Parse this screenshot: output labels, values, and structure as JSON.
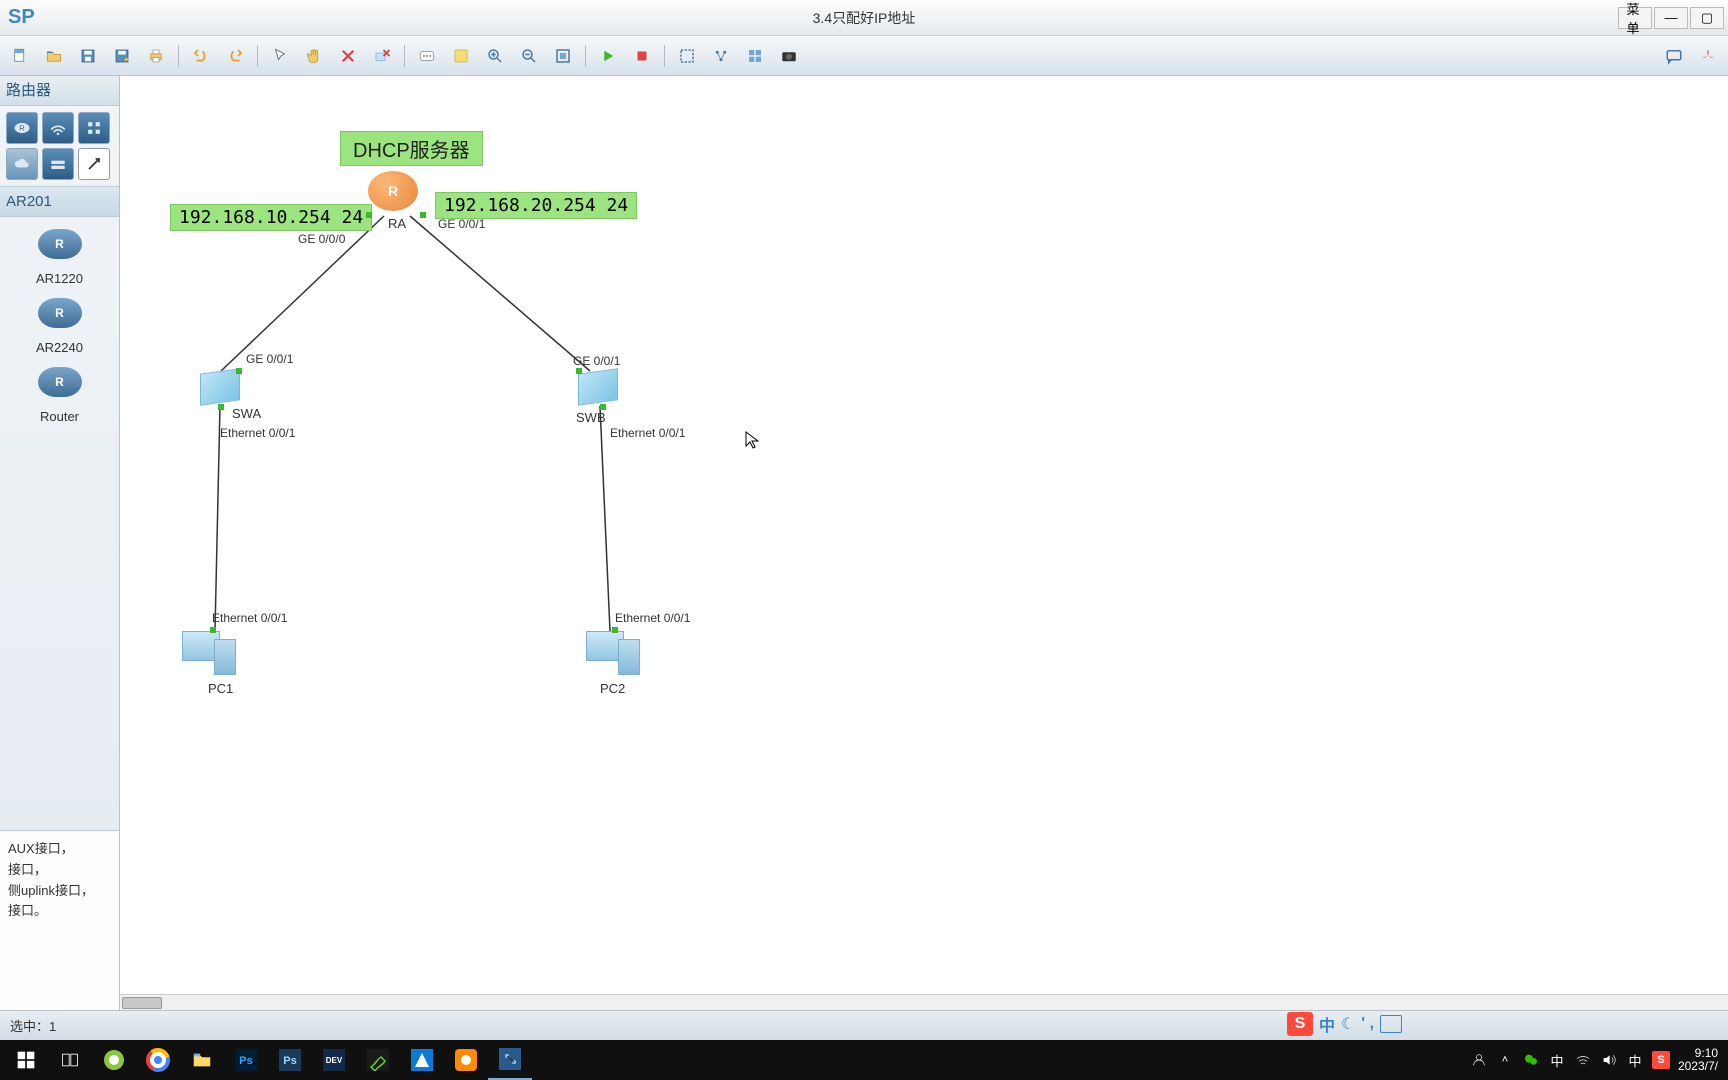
{
  "app": {
    "logo": "SP",
    "title": "3.4只配好IP地址",
    "menu_label": "菜 单"
  },
  "toolbar": {
    "icons": [
      "new",
      "open",
      "save",
      "save-as",
      "print",
      "undo",
      "redo",
      "pointer",
      "hand",
      "delete",
      "delete-node",
      "text",
      "note",
      "zoom-in",
      "zoom-out",
      "fit",
      "play",
      "stop",
      "capture",
      "arrange",
      "grid",
      "camera"
    ]
  },
  "left": {
    "category": "路由器",
    "model_title": "AR201",
    "devices": [
      "AR1220",
      "AR2240",
      "Router"
    ],
    "desc_lines": [
      "AUX接口，",
      "接口，",
      "侧uplink接口，",
      "接口。"
    ]
  },
  "topology": {
    "title": "DHCP服务器",
    "ip_left": "192.168.10.254 24",
    "ip_right": "192.168.20.254 24",
    "ra": {
      "name": "RA",
      "p0": "GE 0/0/0",
      "p1": "GE 0/0/1"
    },
    "swa": {
      "name": "SWA",
      "up": "GE 0/0/1",
      "down": "Ethernet 0/0/1"
    },
    "swb": {
      "name": "SWB",
      "up": "GE 0/0/1",
      "down": "Ethernet 0/0/1"
    },
    "pc1": {
      "name": "PC1",
      "port": "Ethernet 0/0/1"
    },
    "pc2": {
      "name": "PC2",
      "port": "Ethernet 0/0/1"
    }
  },
  "status": {
    "text": "选中：1"
  },
  "tray": {
    "people": "⛉",
    "up": "^",
    "wechat": "✦",
    "lang": "中",
    "wifi": "⬁",
    "vol": "🔊",
    "ime": "中",
    "s": "S",
    "time": "9:10",
    "date": "2023/7/"
  },
  "ime": {
    "s": "S",
    "zh": "中",
    "moon": "☾",
    "comma": "' ,"
  }
}
